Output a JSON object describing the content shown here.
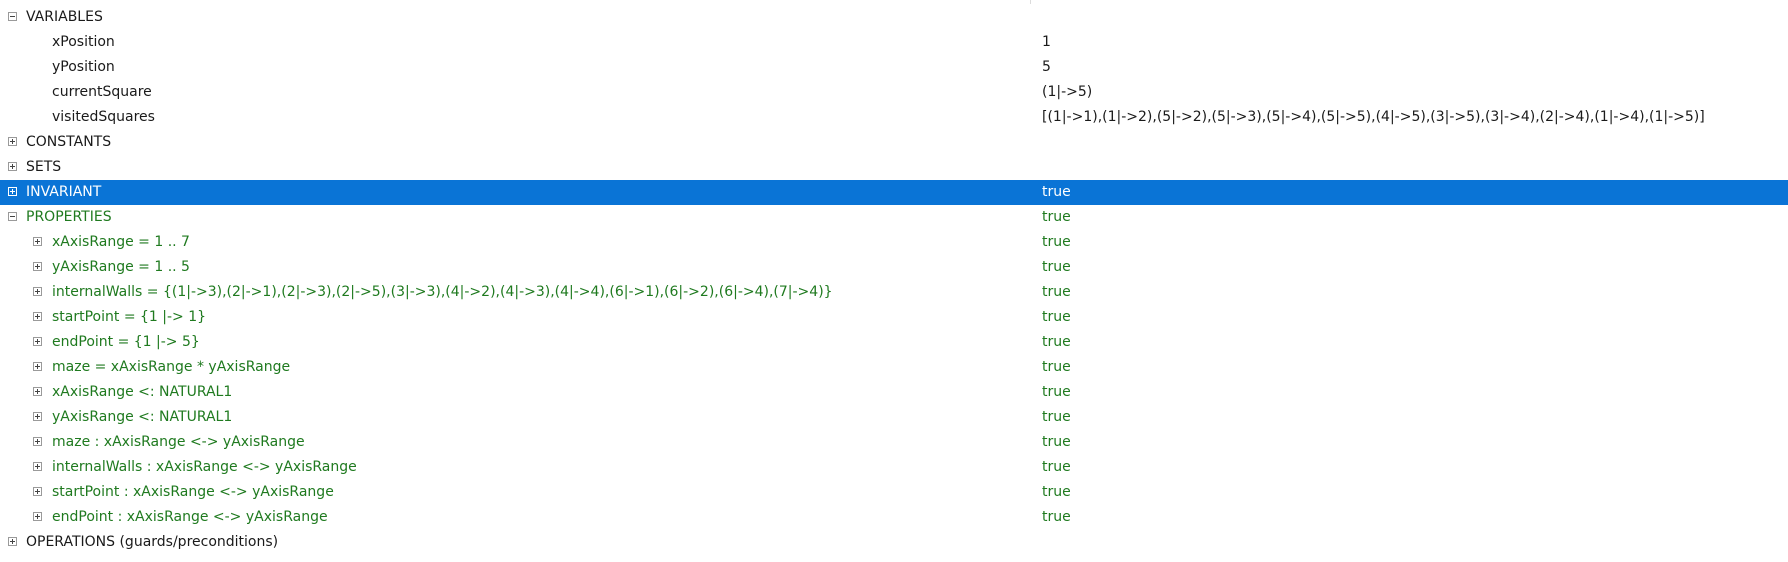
{
  "variables": {
    "header": "VARIABLES",
    "rows": [
      {
        "name": "xPosition",
        "value": "1"
      },
      {
        "name": "yPosition",
        "value": "5"
      },
      {
        "name": "currentSquare",
        "value": "(1|->5)"
      },
      {
        "name": "visitedSquares",
        "value": "[(1|->1),(1|->2),(5|->2),(5|->3),(5|->4),(5|->5),(4|->5),(3|->5),(3|->4),(2|->4),(1|->4),(1|->5)]"
      }
    ]
  },
  "constants": {
    "header": "CONSTANTS"
  },
  "sets": {
    "header": "SETS"
  },
  "invariant": {
    "header": "INVARIANT",
    "value": "true"
  },
  "properties": {
    "header": "PROPERTIES",
    "value": "true",
    "rows": [
      {
        "name": "xAxisRange = 1 .. 7",
        "value": "true"
      },
      {
        "name": "yAxisRange = 1 .. 5",
        "value": "true"
      },
      {
        "name": "internalWalls = {(1|->3),(2|->1),(2|->3),(2|->5),(3|->3),(4|->2),(4|->3),(4|->4),(6|->1),(6|->2),(6|->4),(7|->4)}",
        "value": "true"
      },
      {
        "name": "startPoint = {1 |-> 1}",
        "value": "true"
      },
      {
        "name": "endPoint = {1 |-> 5}",
        "value": "true"
      },
      {
        "name": "maze = xAxisRange * yAxisRange",
        "value": "true"
      },
      {
        "name": "xAxisRange <: NATURAL1",
        "value": "true"
      },
      {
        "name": "yAxisRange <: NATURAL1",
        "value": "true"
      },
      {
        "name": "maze : xAxisRange <-> yAxisRange",
        "value": "true"
      },
      {
        "name": "internalWalls : xAxisRange <-> yAxisRange",
        "value": "true"
      },
      {
        "name": "startPoint : xAxisRange <-> yAxisRange",
        "value": "true"
      },
      {
        "name": "endPoint : xAxisRange <-> yAxisRange",
        "value": "true"
      }
    ]
  },
  "operations": {
    "header": "OPERATIONS (guards/preconditions)"
  },
  "colors": {
    "selection": "#0a74d6",
    "true_value": "#1f7a1f"
  }
}
